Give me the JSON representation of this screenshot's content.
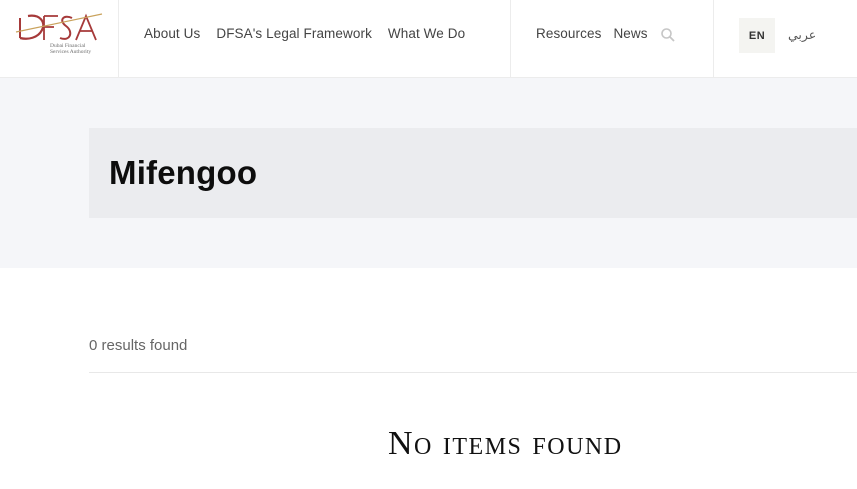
{
  "logo": {
    "wordmark": "DFSA",
    "tagline": [
      "Dubai Financial",
      "Services Authority"
    ],
    "brand_color": "#a63a3a"
  },
  "nav": {
    "main": [
      "About Us",
      "DFSA's Legal Framework",
      "What We Do"
    ],
    "secondary": [
      "Resources",
      "News"
    ],
    "search_icon": "search-icon"
  },
  "language": {
    "active": "EN",
    "alternate": "عربي"
  },
  "page": {
    "title": "Mifengoo"
  },
  "results": {
    "count_text": "0 results found",
    "empty_message": "No items found"
  }
}
